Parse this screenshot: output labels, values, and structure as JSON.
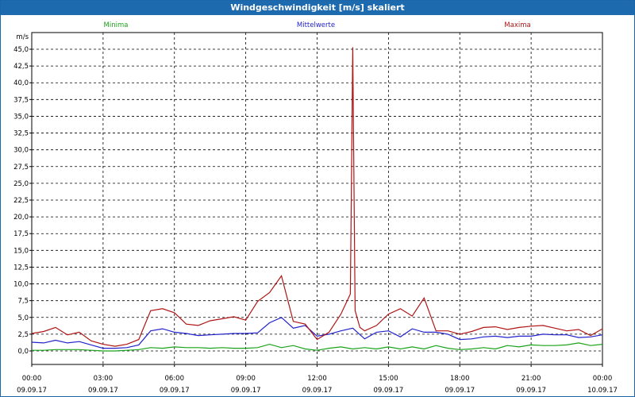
{
  "window": {
    "title": "Windgeschwindigkeit [m/s] skaliert"
  },
  "colors": {
    "minima": "#1aa31a",
    "mittelwerte": "#2222cc",
    "maxima": "#b01515",
    "title_bg": "#1e6aae"
  },
  "chart_data": {
    "type": "line",
    "title": "Windgeschwindigkeit [m/s] skaliert",
    "ylabel": "m/s",
    "ylim": [
      0,
      45
    ],
    "yticks": [
      "0,0",
      "2,5",
      "5,0",
      "7,5",
      "10,0",
      "12,5",
      "15,0",
      "17,5",
      "20,0",
      "22,5",
      "25,0",
      "27,5",
      "30,0",
      "32,5",
      "35,0",
      "37,5",
      "40,0",
      "42,5",
      "45,0"
    ],
    "xlim_hours": [
      0,
      24
    ],
    "xticks": [
      {
        "time": "00:00",
        "date": "09.09.17"
      },
      {
        "time": "03:00",
        "date": "09.09.17"
      },
      {
        "time": "06:00",
        "date": "09.09.17"
      },
      {
        "time": "09:00",
        "date": "09.09.17"
      },
      {
        "time": "12:00",
        "date": "09.09.17"
      },
      {
        "time": "15:00",
        "date": "09.09.17"
      },
      {
        "time": "18:00",
        "date": "09.09.17"
      },
      {
        "time": "21:00",
        "date": "09.09.17"
      },
      {
        "time": "00:00",
        "date": "10.09.17"
      }
    ],
    "grid": true,
    "legend_position": "top",
    "series": [
      {
        "name": "Minima",
        "x": [
          0,
          0.5,
          1,
          1.5,
          2,
          2.5,
          3,
          3.5,
          4,
          4.5,
          5,
          5.5,
          6,
          6.5,
          7,
          7.5,
          8,
          8.5,
          9,
          9.5,
          10,
          10.5,
          11,
          11.5,
          12,
          12.5,
          13,
          13.5,
          14,
          14.5,
          15,
          15.5,
          16,
          16.5,
          17,
          17.5,
          18,
          18.5,
          19,
          19.5,
          20,
          20.5,
          21,
          21.5,
          22,
          22.5,
          23,
          23.5,
          24
        ],
        "y": [
          0.1,
          0.1,
          0.2,
          0.2,
          0.2,
          0.1,
          0.0,
          0.0,
          0.1,
          0.2,
          0.5,
          0.4,
          0.6,
          0.5,
          0.5,
          0.4,
          0.5,
          0.4,
          0.4,
          0.5,
          1.0,
          0.5,
          0.8,
          0.3,
          0.1,
          0.4,
          0.6,
          0.3,
          0.5,
          0.3,
          0.6,
          0.3,
          0.6,
          0.3,
          0.8,
          0.4,
          0.2,
          0.3,
          0.5,
          0.3,
          0.8,
          0.6,
          0.9,
          0.8,
          0.8,
          0.9,
          1.2,
          0.8,
          1.0
        ]
      },
      {
        "name": "Mittelwerte",
        "x": [
          0,
          0.5,
          1,
          1.5,
          2,
          2.5,
          3,
          3.5,
          4,
          4.5,
          5,
          5.5,
          6,
          6.5,
          7,
          7.5,
          8,
          8.5,
          9,
          9.5,
          10,
          10.5,
          11,
          11.5,
          12,
          12.5,
          13,
          13.5,
          14,
          14.5,
          15,
          15.5,
          16,
          16.5,
          17,
          17.5,
          18,
          18.5,
          19,
          19.5,
          20,
          20.5,
          21,
          21.5,
          22,
          22.5,
          23,
          23.5,
          24
        ],
        "y": [
          1.3,
          1.2,
          1.6,
          1.2,
          1.4,
          0.9,
          0.4,
          0.4,
          0.5,
          0.9,
          3.0,
          3.3,
          2.8,
          2.6,
          2.3,
          2.4,
          2.5,
          2.6,
          2.6,
          2.7,
          4.2,
          5.0,
          3.4,
          3.8,
          2.2,
          2.5,
          3.0,
          3.4,
          1.8,
          2.8,
          3.0,
          2.1,
          3.3,
          2.8,
          2.8,
          2.5,
          1.7,
          1.8,
          2.1,
          2.2,
          2.0,
          2.2,
          2.2,
          2.5,
          2.4,
          2.4,
          2.0,
          2.1,
          2.4
        ]
      },
      {
        "name": "Maxima",
        "x": [
          0,
          0.5,
          1,
          1.5,
          2,
          2.5,
          3,
          3.5,
          4,
          4.5,
          5,
          5.5,
          6,
          6.5,
          7,
          7.5,
          8,
          8.5,
          9,
          9.5,
          10,
          10.5,
          11,
          11.5,
          12,
          12.5,
          13,
          13.4,
          13.5,
          13.6,
          13.8,
          14,
          14.5,
          15,
          15.5,
          16,
          16.5,
          17,
          17.5,
          18,
          18.5,
          19,
          19.5,
          20,
          20.5,
          21,
          21.5,
          22,
          22.5,
          23,
          23.5,
          24
        ],
        "y": [
          2.6,
          2.9,
          3.5,
          2.4,
          2.8,
          1.5,
          1.0,
          0.7,
          1.0,
          1.7,
          6.0,
          6.3,
          5.7,
          4.0,
          3.8,
          4.5,
          4.8,
          5.1,
          4.6,
          7.4,
          8.7,
          11.2,
          4.4,
          4.0,
          1.7,
          2.8,
          5.5,
          8.5,
          45.3,
          6.0,
          3.5,
          3.0,
          3.8,
          5.5,
          6.3,
          5.2,
          7.9,
          3.0,
          3.0,
          2.5,
          2.9,
          3.5,
          3.6,
          3.2,
          3.5,
          3.7,
          3.8,
          3.4,
          3.0,
          3.2,
          2.3,
          3.3
        ]
      }
    ]
  }
}
